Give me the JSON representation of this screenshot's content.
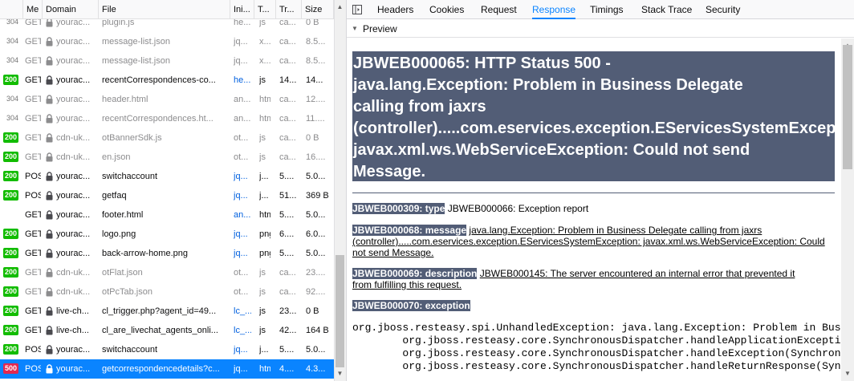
{
  "network": {
    "columns": [
      "Me",
      "Domain",
      "File",
      "Ini...",
      "T...",
      "Tr...",
      "Size"
    ],
    "rows": [
      {
        "status": "304",
        "method": "GET",
        "domain": "yourac...",
        "file": "plugin.js",
        "initiator": "he...",
        "type": "js",
        "transferred": "ca...",
        "size": "0 B",
        "dim": true
      },
      {
        "status": "304",
        "method": "GET",
        "domain": "yourac...",
        "file": "message-list.json",
        "initiator": "jq...",
        "type": "x...",
        "transferred": "ca...",
        "size": "8.5...",
        "dim": true
      },
      {
        "status": "304",
        "method": "GET",
        "domain": "yourac...",
        "file": "message-list.json",
        "initiator": "jq...",
        "type": "x...",
        "transferred": "ca...",
        "size": "8.5...",
        "dim": true
      },
      {
        "status": "200",
        "method": "GET",
        "domain": "yourac...",
        "file": "recentCorrespondences-co...",
        "initiator": "he...",
        "type": "js",
        "transferred": "14....",
        "size": "14...",
        "dim": false
      },
      {
        "status": "304",
        "method": "GET",
        "domain": "yourac...",
        "file": "header.html",
        "initiator": "an...",
        "type": "htm",
        "transferred": "ca...",
        "size": "12....",
        "dim": true
      },
      {
        "status": "304",
        "method": "GET",
        "domain": "yourac...",
        "file": "recentCorrespondences.ht...",
        "initiator": "an...",
        "type": "htm",
        "transferred": "ca...",
        "size": "11....",
        "dim": true
      },
      {
        "status": "200",
        "method": "GET",
        "domain": "cdn-uk...",
        "file": "otBannerSdk.js",
        "initiator": "ot...",
        "type": "js",
        "transferred": "ca...",
        "size": "0 B",
        "dim": true
      },
      {
        "status": "200",
        "method": "GET",
        "domain": "cdn-uk...",
        "file": "en.json",
        "initiator": "ot...",
        "type": "js",
        "transferred": "ca...",
        "size": "16....",
        "dim": true
      },
      {
        "status": "200",
        "method": "POS",
        "domain": "yourac...",
        "file": "switchaccount",
        "initiator": "jq...",
        "type": "j...",
        "transferred": "5....",
        "size": "5.0...",
        "dim": false
      },
      {
        "status": "200",
        "method": "POS",
        "domain": "yourac...",
        "file": "getfaq",
        "initiator": "jq...",
        "type": "j...",
        "transferred": "51....",
        "size": "369 B",
        "dim": false
      },
      {
        "status": "",
        "method": "GET",
        "domain": "yourac...",
        "file": "footer.html",
        "initiator": "an...",
        "type": "htm",
        "transferred": "5....",
        "size": "5.0...",
        "dim": false
      },
      {
        "status": "200",
        "method": "GET",
        "domain": "yourac...",
        "file": "logo.png",
        "initiator": "jq...",
        "type": "png",
        "transferred": "6....",
        "size": "6.0...",
        "dim": false
      },
      {
        "status": "200",
        "method": "GET",
        "domain": "yourac...",
        "file": "back-arrow-home.png",
        "initiator": "jq...",
        "type": "png",
        "transferred": "5....",
        "size": "5.0...",
        "dim": false
      },
      {
        "status": "200",
        "method": "GET",
        "domain": "cdn-uk...",
        "file": "otFlat.json",
        "initiator": "ot...",
        "type": "js",
        "transferred": "ca...",
        "size": "23....",
        "dim": true
      },
      {
        "status": "200",
        "method": "GET",
        "domain": "cdn-uk...",
        "file": "otPcTab.json",
        "initiator": "ot...",
        "type": "js",
        "transferred": "ca...",
        "size": "92....",
        "dim": true
      },
      {
        "status": "200",
        "method": "GET",
        "domain": "live-ch...",
        "file": "cl_trigger.php?agent_id=49...",
        "initiator": "lc_...",
        "type": "js",
        "transferred": "23....",
        "size": "0 B",
        "dim": false
      },
      {
        "status": "200",
        "method": "GET",
        "domain": "live-ch...",
        "file": "cl_are_livechat_agents_onli...",
        "initiator": "lc_...",
        "type": "js",
        "transferred": "42....",
        "size": "164 B",
        "dim": false
      },
      {
        "status": "200",
        "method": "POS",
        "domain": "yourac...",
        "file": "switchaccount",
        "initiator": "jq...",
        "type": "j...",
        "transferred": "5....",
        "size": "5.0...",
        "dim": false
      },
      {
        "status": "500",
        "method": "POS",
        "domain": "yourac...",
        "file": "getcorrespondencedetails?c...",
        "initiator": "jq...",
        "type": "htm",
        "transferred": "4....",
        "size": "4.3...",
        "dim": false,
        "selected": true
      }
    ]
  },
  "details": {
    "tabs": [
      "Headers",
      "Cookies",
      "Request",
      "Response",
      "Timings",
      "Stack Trace",
      "Security"
    ],
    "active_tab": "Response",
    "preview_label": "Preview",
    "error_title_lines": [
      "JBWEB000065: HTTP Status 500 -",
      "java.lang.Exception: Problem in Business Delegate",
      "calling from jaxrs",
      "(controller).....com.eservices.exception.EServicesSystemException:",
      "javax.xml.ws.WebServiceException: Could not send",
      "Message."
    ],
    "type_label": "JBWEB000309: type",
    "type_value": "JBWEB000066: Exception report",
    "message_label": "JBWEB000068: message",
    "message_value_l1": "java.lang.Exception: Problem in Business Delegate calling from jaxrs",
    "message_value_l2": "(controller).....com.eservices.exception.EServicesSystemException: javax.xml.ws.WebServiceException: Could",
    "message_value_l3": "not send Message.",
    "description_label": "JBWEB000069: description",
    "description_value_l1": "JBWEB000145: The server encountered an internal error that prevented it",
    "description_value_l2": "from fulfilling this request.",
    "exception_label": "JBWEB000070: exception",
    "trace_lines": [
      "org.jboss.resteasy.spi.UnhandledException: java.lang.Exception: Problem in Business Delegate",
      "        org.jboss.resteasy.core.SynchronousDispatcher.handleApplicationException(",
      "        org.jboss.resteasy.core.SynchronousDispatcher.handleException(SynchronousDispatcher",
      "        org.jboss.resteasy.core.SynchronousDispatcher.handleReturnResponse(Synchr"
    ]
  },
  "colors": {
    "accent": "#0a84ff",
    "status_ok": "#12bc00",
    "status_error": "#e22850",
    "error_header_bg": "#525d76"
  }
}
